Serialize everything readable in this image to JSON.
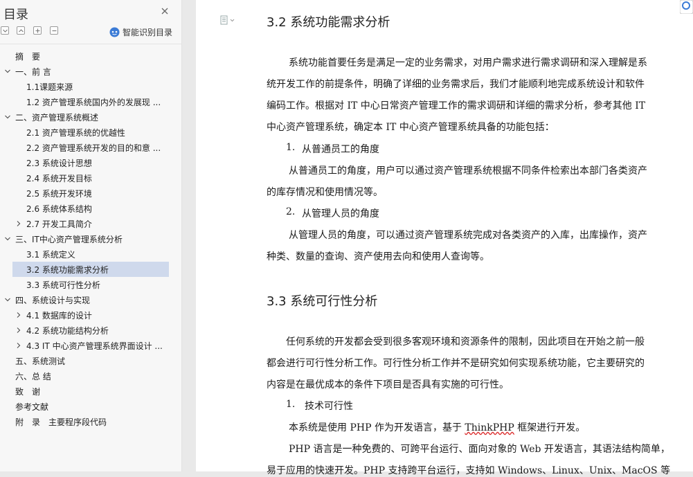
{
  "sidebar": {
    "title": "目录",
    "smart_toc_label": "智能识别目录",
    "toc": [
      {
        "label": "摘　要",
        "expandable": false,
        "expanded": false,
        "level": 1,
        "selected": false
      },
      {
        "label": "一、前 言",
        "expandable": true,
        "expanded": true,
        "level": 1,
        "selected": false
      },
      {
        "label": "1.1课题来源",
        "expandable": false,
        "expanded": false,
        "level": 2,
        "selected": false
      },
      {
        "label": "1.2 资产管理系统国内外的发展现 ...",
        "expandable": false,
        "expanded": false,
        "level": 2,
        "selected": false
      },
      {
        "label": "二、资产管理系统概述",
        "expandable": true,
        "expanded": true,
        "level": 1,
        "selected": false
      },
      {
        "label": "2.1 资产管理系统的优越性",
        "expandable": false,
        "expanded": false,
        "level": 2,
        "selected": false
      },
      {
        "label": "2.2 资产管理系统开发的目的和意 ...",
        "expandable": false,
        "expanded": false,
        "level": 2,
        "selected": false
      },
      {
        "label": "2.3 系统设计思想",
        "expandable": false,
        "expanded": false,
        "level": 2,
        "selected": false
      },
      {
        "label": "2.4 系统开发目标",
        "expandable": false,
        "expanded": false,
        "level": 2,
        "selected": false
      },
      {
        "label": "2.5 系统开发环境",
        "expandable": false,
        "expanded": false,
        "level": 2,
        "selected": false
      },
      {
        "label": "2.6 系统体系结构",
        "expandable": false,
        "expanded": false,
        "level": 2,
        "selected": false
      },
      {
        "label": "2.7 开发工具简介",
        "expandable": true,
        "expanded": false,
        "level": 2,
        "selected": false
      },
      {
        "label": "三、IT中心资产管理系统分析",
        "expandable": true,
        "expanded": true,
        "level": 1,
        "selected": false
      },
      {
        "label": "3.1 系统定义",
        "expandable": false,
        "expanded": false,
        "level": 2,
        "selected": false
      },
      {
        "label": "3.2 系统功能需求分析",
        "expandable": false,
        "expanded": false,
        "level": 2,
        "selected": true
      },
      {
        "label": "3.3 系统可行性分析",
        "expandable": false,
        "expanded": false,
        "level": 2,
        "selected": false
      },
      {
        "label": "四、系统设计与实现",
        "expandable": true,
        "expanded": true,
        "level": 1,
        "selected": false
      },
      {
        "label": "4.1 数据库的设计",
        "expandable": true,
        "expanded": false,
        "level": 2,
        "selected": false
      },
      {
        "label": "4.2 系统功能结构分析",
        "expandable": true,
        "expanded": false,
        "level": 2,
        "selected": false
      },
      {
        "label": "4.3 IT 中心资产管理系统界面设计 ...",
        "expandable": true,
        "expanded": false,
        "level": 2,
        "selected": false
      },
      {
        "label": "五、系统测试",
        "expandable": false,
        "expanded": false,
        "level": 1,
        "selected": false
      },
      {
        "label": "六、总 结",
        "expandable": false,
        "expanded": false,
        "level": 1,
        "selected": false
      },
      {
        "label": "致　谢",
        "expandable": false,
        "expanded": false,
        "level": 1,
        "selected": false
      },
      {
        "label": "参考文献",
        "expandable": false,
        "expanded": false,
        "level": 1,
        "selected": false
      },
      {
        "label": "附　录　主要程序段代码",
        "expandable": false,
        "expanded": false,
        "level": 1,
        "selected": false
      }
    ]
  },
  "document": {
    "heading_32": "3.2 系统功能需求分析",
    "p1_l1": "系统功能首要任务是满足一定的业务需求，对用户需求进行需求调研和深入理解是系",
    "p1_l2": "统开发工作的前提条件，明确了详细的业务需求后，我们才能顺利地完成系统设计和软件",
    "p1_l3": "编码工作。根据对 IT 中心日常资产管理工作的需求调研和详细的需求分析，参考其他 IT",
    "p1_l4": "中心资产管理系统，确定本 IT 中心资产管理系统具备的功能包括：",
    "item1_num": "1.",
    "item1_text": "从普通员工的角度",
    "p2_l1": "从普通员工的角度，用户可以通过资产管理系统根据不同条件检索出本部门各类资产",
    "p2_l2": "的库存情况和使用情况等。",
    "item2_num": "2.",
    "item2_text": "从管理人员的角度",
    "p3_l1": "从管理人员的角度，可以通过资产管理系统完成对各类资产的入库，出库操作，资产",
    "p3_l2": "种类、数量的查询、资产使用去向和使用人查询等。",
    "heading_33": "3.3 系统可行性分析",
    "p4_l1": "任何系统的开发都会受到很多客观环境和资源条件的限制，因此项目在开始之前一般",
    "p4_l2": "都会进行可行性分析工作。可行性分析工作并不是研究如何实现系统功能，它主要研究的",
    "p4_l3": "内容是在最优成本的条件下项目是否具有实施的可行性。",
    "item3_num": "1.",
    "item3_text": "技术可行性",
    "p5_a": "本系统是使用 PHP 作为开发语言，基于 ",
    "p5_b": "ThinkPHP",
    "p5_c": " 框架进行开发。",
    "p6_l1": "PHP 语言是一种免费的、可跨平台运行、面向对象的 Web 开发语言，其语法结构简单，",
    "p6_l2": "易于应用的快速开发。PHP 支持跨平台运行，支持如 Windows、Linux、Unix、MacOS 等"
  },
  "icons": {
    "close": "close-icon",
    "collapse_all": "collapse-all-icon",
    "expand_all": "expand-all-icon",
    "smart": "smart-toc-icon",
    "page": "page-view-icon"
  },
  "colors": {
    "selected_row": "#cfd9ec",
    "accent": "#3b7bd6"
  }
}
